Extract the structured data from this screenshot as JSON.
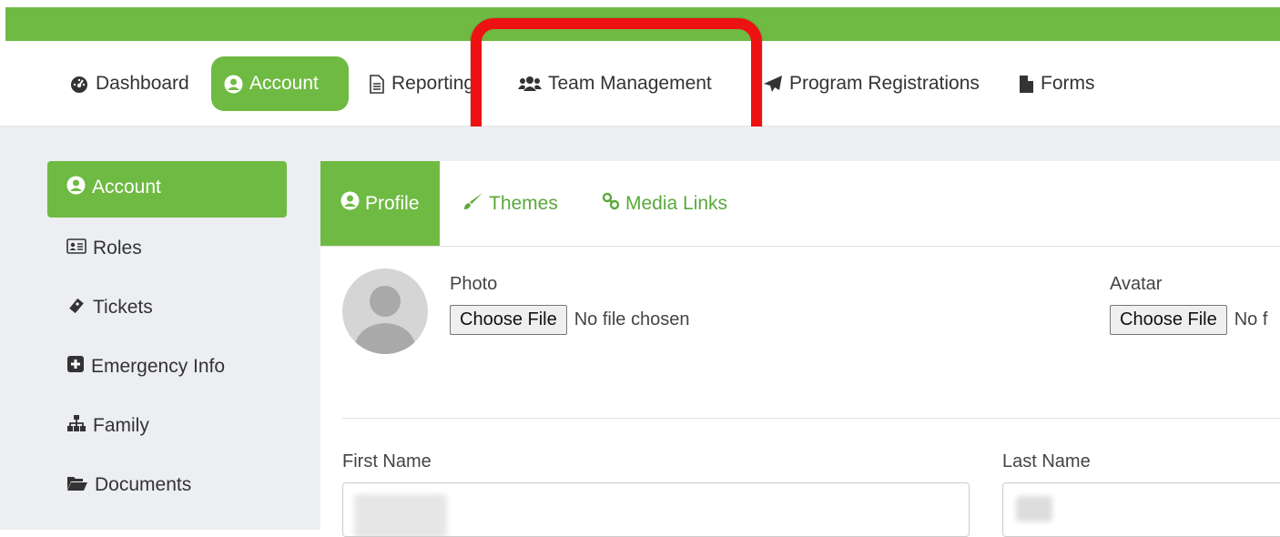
{
  "nav": {
    "items": [
      {
        "label": "Dashboard",
        "icon": "dashboard-icon"
      },
      {
        "label": "Account",
        "icon": "user-circle-icon",
        "active": true
      },
      {
        "label": "Reporting",
        "icon": "document-icon"
      },
      {
        "label": "Team Management",
        "icon": "users-icon",
        "highlighted": true
      },
      {
        "label": "Program Registrations",
        "icon": "paper-plane-icon"
      },
      {
        "label": "Forms",
        "icon": "file-icon"
      }
    ]
  },
  "sidebar": {
    "items": [
      {
        "label": "Account",
        "icon": "user-circle-icon",
        "active": true
      },
      {
        "label": "Roles",
        "icon": "id-card-icon"
      },
      {
        "label": "Tickets",
        "icon": "ticket-icon"
      },
      {
        "label": "Emergency Info",
        "icon": "plus-square-icon"
      },
      {
        "label": "Family",
        "icon": "sitemap-icon"
      },
      {
        "label": "Documents",
        "icon": "folder-open-icon"
      }
    ]
  },
  "tabs": [
    {
      "label": "Profile",
      "icon": "user-circle-icon",
      "active": true
    },
    {
      "label": "Themes",
      "icon": "paint-brush-icon"
    },
    {
      "label": "Media Links",
      "icon": "link-icon"
    }
  ],
  "profile": {
    "photo_label": "Photo",
    "photo_button": "Choose File",
    "photo_status": "No file chosen",
    "avatar_label": "Avatar",
    "avatar_button": "Choose File",
    "avatar_status": "No f",
    "first_name_label": "First Name",
    "last_name_label": "Last Name"
  },
  "colors": {
    "brand_green": "#6fba43",
    "highlight_red": "#ee1111",
    "link_green": "#5aa93a"
  }
}
